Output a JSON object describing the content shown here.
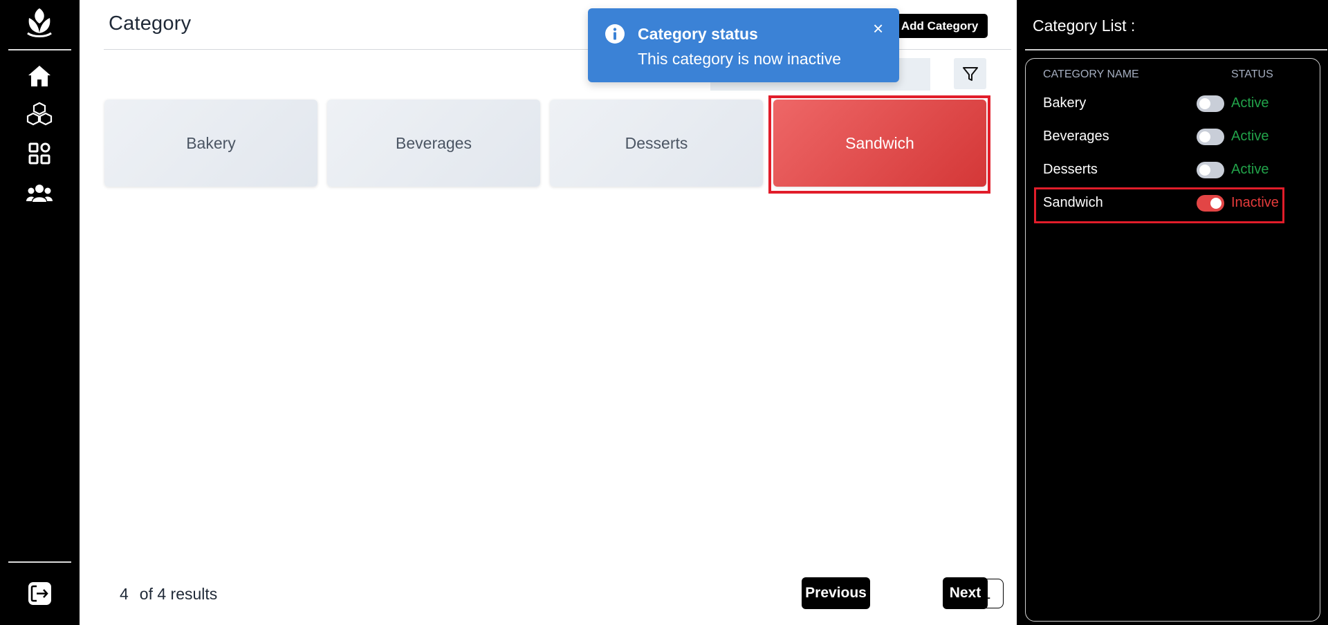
{
  "sidebar": {
    "nav_items": [
      {
        "name": "home-icon"
      },
      {
        "name": "cubes-icon"
      },
      {
        "name": "grid-icon"
      },
      {
        "name": "users-icon"
      }
    ],
    "logout_icon": "logout-icon"
  },
  "main": {
    "title": "Category",
    "add_button_label": "Add Category",
    "search": {
      "value": "",
      "placeholder": ""
    },
    "categories": [
      {
        "label": "Bakery",
        "selected": false
      },
      {
        "label": "Beverages",
        "selected": false
      },
      {
        "label": "Desserts",
        "selected": false
      },
      {
        "label": "Sandwich",
        "selected": true
      }
    ],
    "results": {
      "count": "4",
      "text": "of 4 results"
    },
    "pagination": {
      "previous": "Previous",
      "page": "1",
      "next": "Next"
    }
  },
  "toast": {
    "title": "Category status",
    "message": "This category is now inactive",
    "close": "×"
  },
  "panel": {
    "title": "Category List :",
    "col_name": "CATEGORY NAME",
    "col_status": "STATUS",
    "rows": [
      {
        "name": "Bakery",
        "toggle_on": false,
        "status": "Active"
      },
      {
        "name": "Beverages",
        "toggle_on": false,
        "status": "Active"
      },
      {
        "name": "Desserts",
        "toggle_on": false,
        "status": "Active"
      },
      {
        "name": "Sandwich",
        "toggle_on": true,
        "status": "Inactive"
      }
    ]
  },
  "colors": {
    "active": "#22a34a",
    "inactive": "#e53b3b",
    "toast_bg": "#3b82d6",
    "highlight": "#e11d2a"
  }
}
